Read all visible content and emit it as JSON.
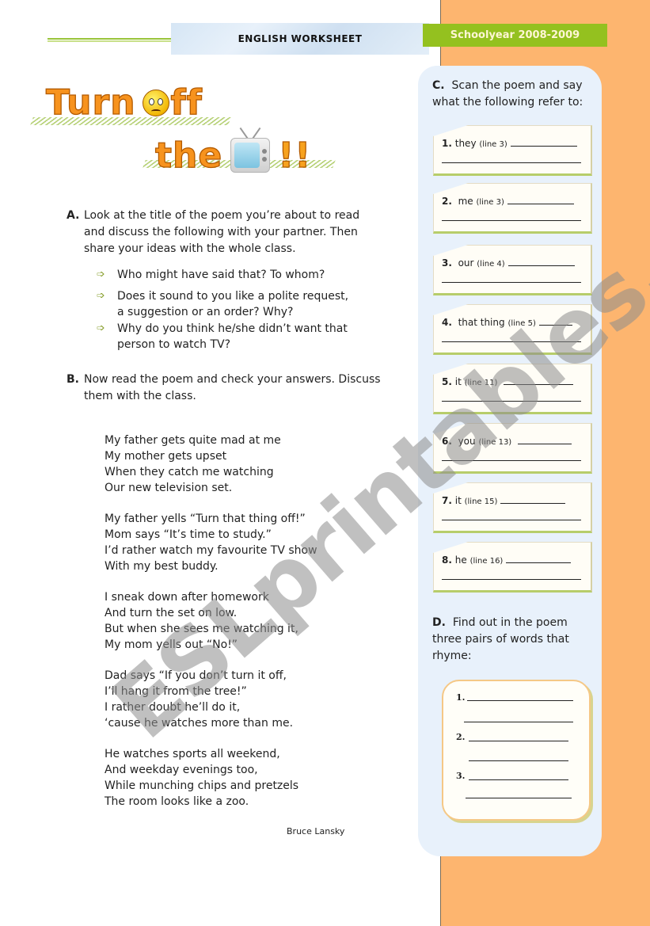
{
  "header": {
    "title": "ENGLISH WORKSHEET",
    "schoolyear": "Schoolyear 2008-2009"
  },
  "title_art": {
    "line1_word1": "Turn",
    "line1_o_icon": "angry-smiley-icon",
    "line1_word2": "ff",
    "line2_word1": "the",
    "line2_tv_icon": "television-icon",
    "line2_exclaim": "!!"
  },
  "section_a": {
    "letter": "A.",
    "text_lines": [
      "Look at the title of the poem you’re about to read",
      "and discuss the following with your partner. Then",
      "share your ideas with the whole class."
    ],
    "bullets": [
      [
        "Who might have said that? To whom?"
      ],
      [
        "Does it sound to you like a polite request,",
        "a suggestion or an order? Why?"
      ],
      [
        "Why do you think he/she didn’t want that",
        "person to watch TV?"
      ]
    ]
  },
  "section_b": {
    "letter": "B.",
    "text_lines": [
      "Now read the poem and check your answers. Discuss",
      "them with the class."
    ]
  },
  "poem": {
    "stanzas": [
      [
        "My father gets quite mad at me",
        "My mother gets upset",
        "When they catch me watching",
        "Our new television set."
      ],
      [
        "My father yells “Turn that thing off!”",
        "Mom says “It’s time to study.”",
        "I’d rather watch my favourite TV show",
        "With my best buddy."
      ],
      [
        "I sneak down after homework",
        "And turn the set on low.",
        "But when she sees me watching it,",
        "My mom yells out “No!”"
      ],
      [
        "Dad says “If you don’t turn it off,",
        "I’ll hang it from the tree!”",
        "I rather doubt he’ll do it,",
        "‘cause he watches more than me."
      ],
      [
        "He watches sports all weekend,",
        "And weekday evenings too,",
        "While munching chips and pretzels",
        "The room looks like a zoo."
      ]
    ],
    "author": "Bruce Lansky"
  },
  "section_c": {
    "letter": "C.",
    "text_lines": [
      "Scan the poem and say",
      "what the following refer to:"
    ],
    "items": [
      {
        "num": "1.",
        "word": "they",
        "ref": "(line 3)"
      },
      {
        "num": "2.",
        "word": "me",
        "ref": "(line 3)"
      },
      {
        "num": "3.",
        "word": "our",
        "ref": "(line 4)"
      },
      {
        "num": "4.",
        "word": "that thing",
        "ref": "(line 5)"
      },
      {
        "num": "5.",
        "word": "it",
        "ref": "(line 11)"
      },
      {
        "num": "6.",
        "word": "you",
        "ref": "(line 13)"
      },
      {
        "num": "7.",
        "word": "it",
        "ref": "(line 15)"
      },
      {
        "num": "8.",
        "word": "he",
        "ref": "(line 16)"
      }
    ]
  },
  "section_d": {
    "letter": "D.",
    "text_lines": [
      "Find out in the poem",
      "three pairs of words that",
      "rhyme:"
    ],
    "rows": [
      "1.",
      "2.",
      "3."
    ]
  },
  "watermark": "ESLprintables.com",
  "colors": {
    "orange_column": "#fdb56f",
    "green_accent": "#94c11f",
    "panel_blue": "#e8f1fb",
    "title_orange": "#f7931e"
  }
}
